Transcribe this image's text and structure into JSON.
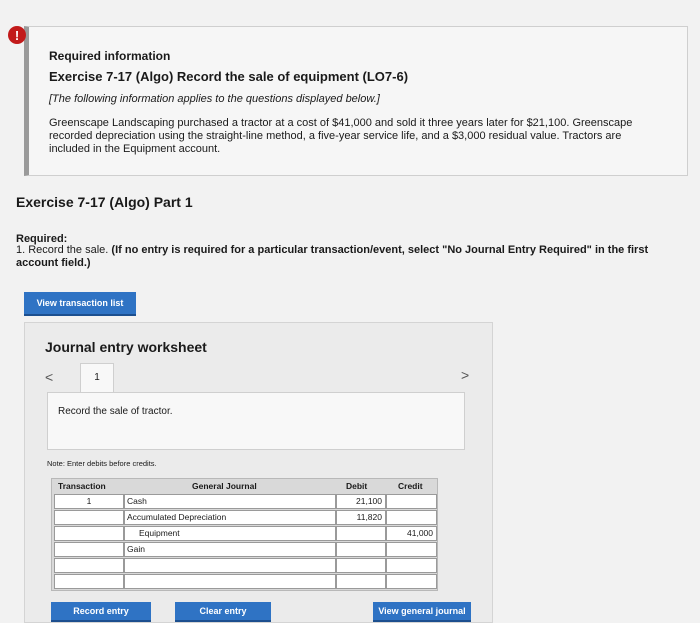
{
  "info": {
    "alert_icon": "!",
    "title": "Required information",
    "exercise": "Exercise 7-17 (Algo) Record the sale of equipment (LO7-6)",
    "note": "[The following information applies to the questions displayed below.]",
    "paragraph": "Greenscape Landscaping purchased a tractor at a cost of $41,000 and sold it three years later for $21,100. Greenscape recorded depreciation using the straight-line method, a five-year service life, and a $3,000 residual value. Tractors are included in the Equipment account."
  },
  "part": {
    "title": "Exercise 7-17 (Algo) Part 1",
    "required_label": "Required:",
    "required_text": "1. Record the sale.",
    "required_bold": "(If no entry is required for a particular transaction/event, select \"No Journal Entry Required\" in the first account field.)"
  },
  "buttons": {
    "view_transaction_list": "View transaction list",
    "record_entry": "Record entry",
    "clear_entry": "Clear entry",
    "view_general_journal": "View general journal"
  },
  "worksheet": {
    "title": "Journal entry worksheet",
    "prev_icon": "<",
    "next_icon": ">",
    "tab": "1",
    "description": "Record the sale of tractor.",
    "note": "Note: Enter debits before credits."
  },
  "journal": {
    "headers": {
      "transaction": "Transaction",
      "general_journal": "General Journal",
      "debit": "Debit",
      "credit": "Credit"
    },
    "rows": [
      {
        "transaction": "1",
        "account": "Cash",
        "debit": "21,100",
        "credit": ""
      },
      {
        "transaction": "",
        "account": "Accumulated Depreciation",
        "debit": "11,820",
        "credit": ""
      },
      {
        "transaction": "",
        "account": "Equipment",
        "debit": "",
        "credit": "41,000"
      },
      {
        "transaction": "",
        "account": "Gain",
        "debit": "",
        "credit": ""
      },
      {
        "transaction": "",
        "account": "",
        "debit": "",
        "credit": ""
      },
      {
        "transaction": "",
        "account": "",
        "debit": "",
        "credit": ""
      }
    ]
  },
  "colors": {
    "button_blue": "#2f73c4",
    "alert_red": "#c21a1a"
  }
}
